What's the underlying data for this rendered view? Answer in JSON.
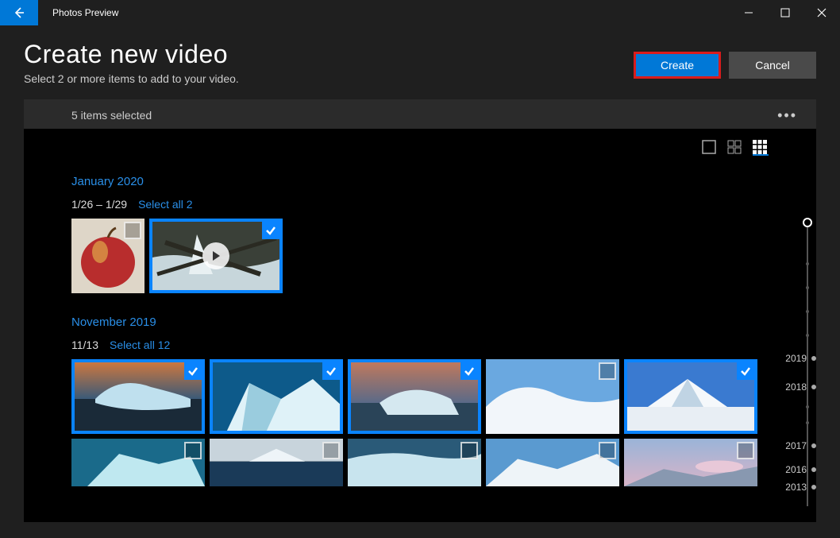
{
  "app_title": "Photos Preview",
  "header": {
    "title": "Create new video",
    "subtitle": "Select 2 or more items to add to your video.",
    "create_label": "Create",
    "cancel_label": "Cancel"
  },
  "selection_bar": {
    "count_text": "5 items selected"
  },
  "groups": [
    {
      "month_label": "January 2020",
      "date_range": "1/26 – 1/29",
      "select_all_label": "Select all 2"
    },
    {
      "month_label": "November 2019",
      "date_range": "11/13",
      "select_all_label": "Select all 12"
    }
  ],
  "timeline_years": [
    "2019",
    "2018",
    "2017",
    "2016",
    "2013"
  ]
}
